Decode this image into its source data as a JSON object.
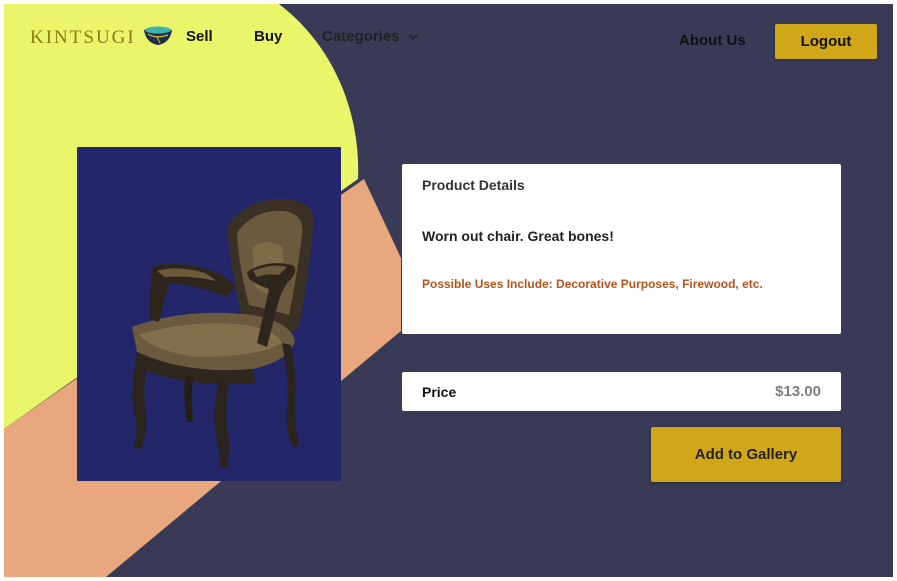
{
  "brand": {
    "name": "KINTSUGI",
    "logo_icon": "kintsugi-bowl-icon"
  },
  "nav": {
    "sell": "Sell",
    "buy": "Buy",
    "categories": "Categories",
    "categories_icon": "chevron-down-icon",
    "about": "About Us",
    "logout": "Logout"
  },
  "product": {
    "image_subject": "antique armchair",
    "details_title": "Product Details",
    "description": "Worn out chair. Great bones!",
    "uses": "Possible Uses Include:  Decorative Purposes, Firewood, etc.",
    "price_label": "Price",
    "price_value": "$13.00",
    "add_button": "Add to  Gallery"
  },
  "colors": {
    "background": "#393a56",
    "accent_yellow": "#eaf56a",
    "accent_peach": "#e8a77c",
    "button_gold": "#d1a71a",
    "image_bg": "#23276a",
    "uses_text": "#b5541c"
  }
}
